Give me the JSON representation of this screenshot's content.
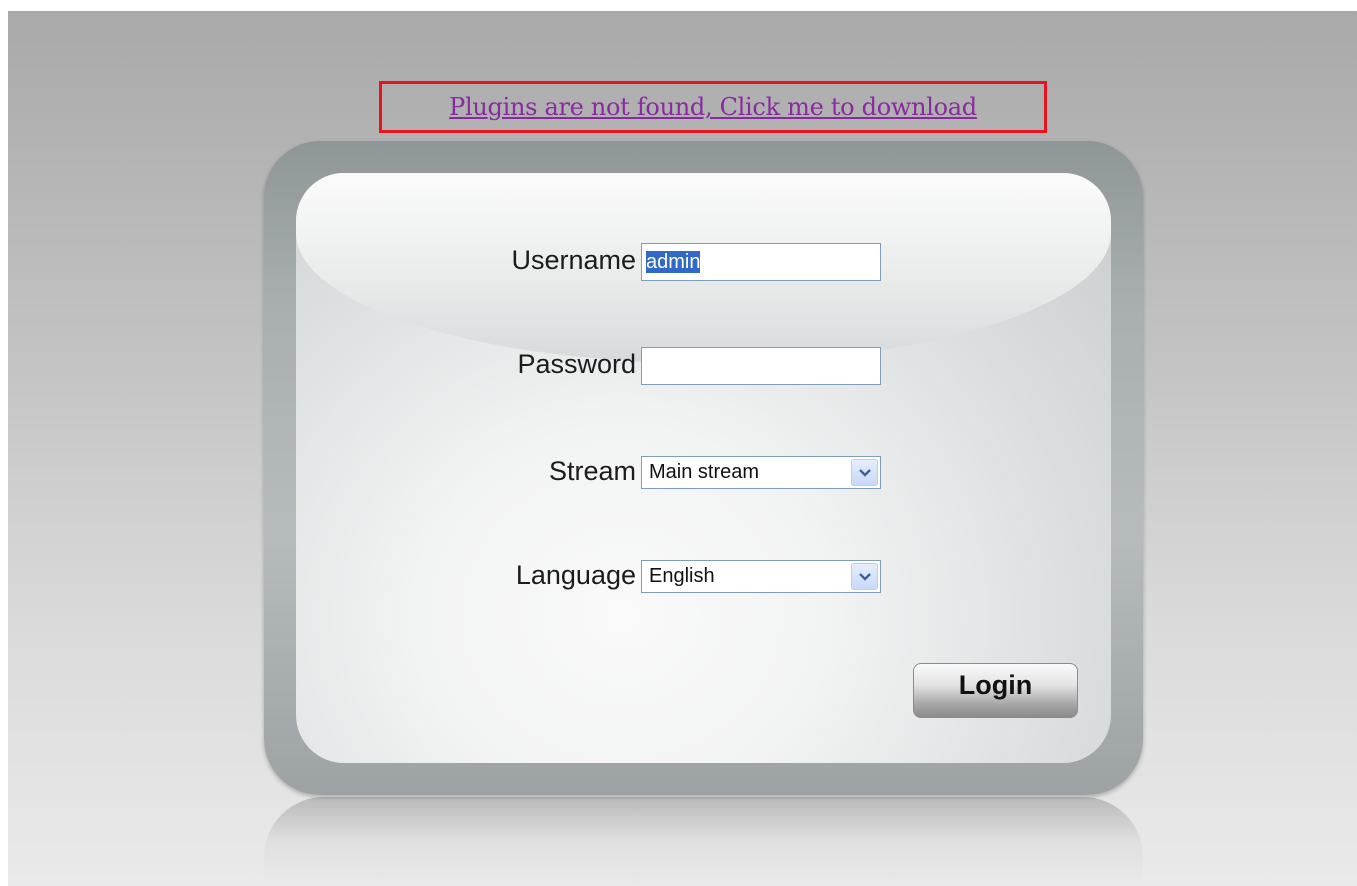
{
  "plugin_notice": {
    "link_text": "Plugins are not found, Click me to download"
  },
  "login_form": {
    "username": {
      "label": "Username",
      "value": "admin"
    },
    "password": {
      "label": "Password",
      "value": ""
    },
    "stream": {
      "label": "Stream",
      "selected": "Main stream"
    },
    "language": {
      "label": "Language",
      "selected": "English"
    },
    "login_button": "Login"
  },
  "colors": {
    "notice_border": "#e5141f",
    "link": "#8a2aa0",
    "selection": "#3169c6"
  },
  "icons": {
    "dropdown": "chevron-down-icon"
  }
}
